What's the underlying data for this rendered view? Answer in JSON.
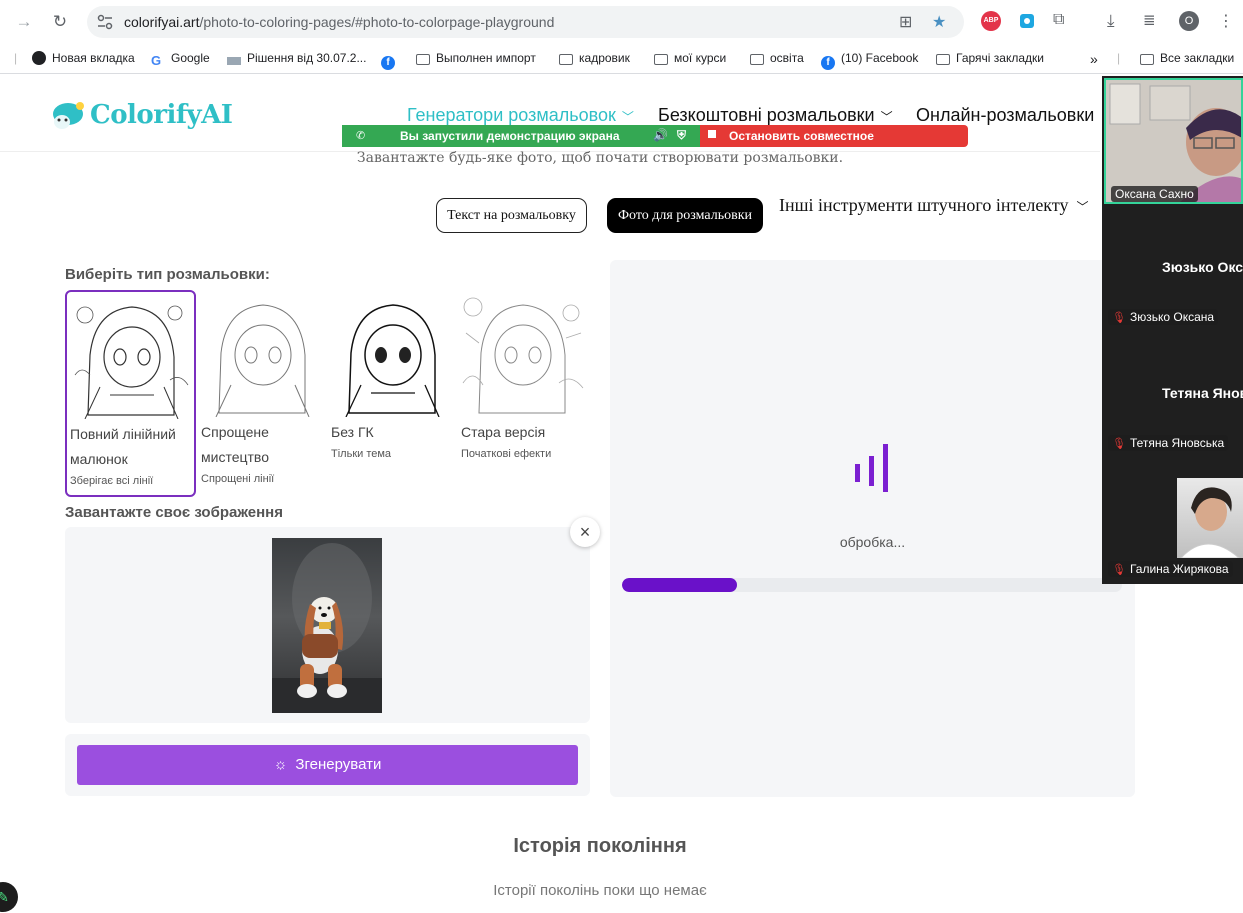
{
  "browser": {
    "url_domain": "colorifyai.art",
    "url_path": "/photo-to-coloring-pages/#photo-to-colorpage-playground",
    "profile_initial": "O"
  },
  "bookmarks": [
    {
      "label": "Новая вкладка",
      "icon": "globe-icon"
    },
    {
      "label": "Google",
      "icon": "google-icon"
    },
    {
      "label": "Рішення від 30.07.2...",
      "icon": "site-icon"
    },
    {
      "label": "",
      "icon": "facebook-icon"
    },
    {
      "label": "Выполнен импорт",
      "icon": "folder-icon"
    },
    {
      "label": "кадровик",
      "icon": "folder-icon"
    },
    {
      "label": "мої курси",
      "icon": "folder-icon"
    },
    {
      "label": "освіта",
      "icon": "folder-icon"
    },
    {
      "label": "(10) Facebook",
      "icon": "facebook-icon"
    },
    {
      "label": "Гарячі закладки",
      "icon": "folder-icon"
    }
  ],
  "bookmarks_all": "Все закладки",
  "site": {
    "logo_text": "ColorifyAI",
    "menu": [
      {
        "label": "Генератори розмальовок",
        "color": "#2fbfc6"
      },
      {
        "label": "Безкоштовні розмальовки",
        "color": "#111111"
      },
      {
        "label": "Онлайн-розмальовки",
        "color": "#111111"
      }
    ],
    "subtitle": "Завантажте будь-яке фото, щоб почати створювати розмальовки.",
    "tabs": {
      "text": "Текст на розмальовку",
      "photo": "Фото для розмальовки",
      "other": "Інші інструменти штучного інтелекту"
    },
    "choose_type_title": "Виберіть тип розмальовки:",
    "types": [
      {
        "name": "Повний лінійний малюнок",
        "desc": "Зберігає всі лінії",
        "selected": true
      },
      {
        "name": "Спрощене мистецтво",
        "desc": "Спрощені лінії",
        "selected": false
      },
      {
        "name": "Без ГК",
        "desc": "Тільки тема",
        "selected": false
      },
      {
        "name": "Стара версія",
        "desc": "Початкові ефекти",
        "selected": false
      }
    ],
    "upload_title": "Завантажте своє зображення",
    "generate_label": "Згенерувати",
    "processing_label": "обробка...",
    "progress": 0.23,
    "accent": "#9b4fdf",
    "history_title": "Історія покоління",
    "history_empty": "Історії поколінь поки що немає"
  },
  "screen_share": {
    "notice": "Вы запустили демонстрацию экрана",
    "stop": "Остановить совместное использование"
  },
  "call": {
    "self_name": "Оксана Сахно",
    "participants": [
      {
        "big_name": "Зюзько Окс",
        "label": "Зюзько Оксана"
      },
      {
        "big_name": "Тетяна Янов",
        "label": "Тетяна Яновська"
      },
      {
        "big_name": "",
        "label": "Галина Жирякова"
      }
    ]
  }
}
